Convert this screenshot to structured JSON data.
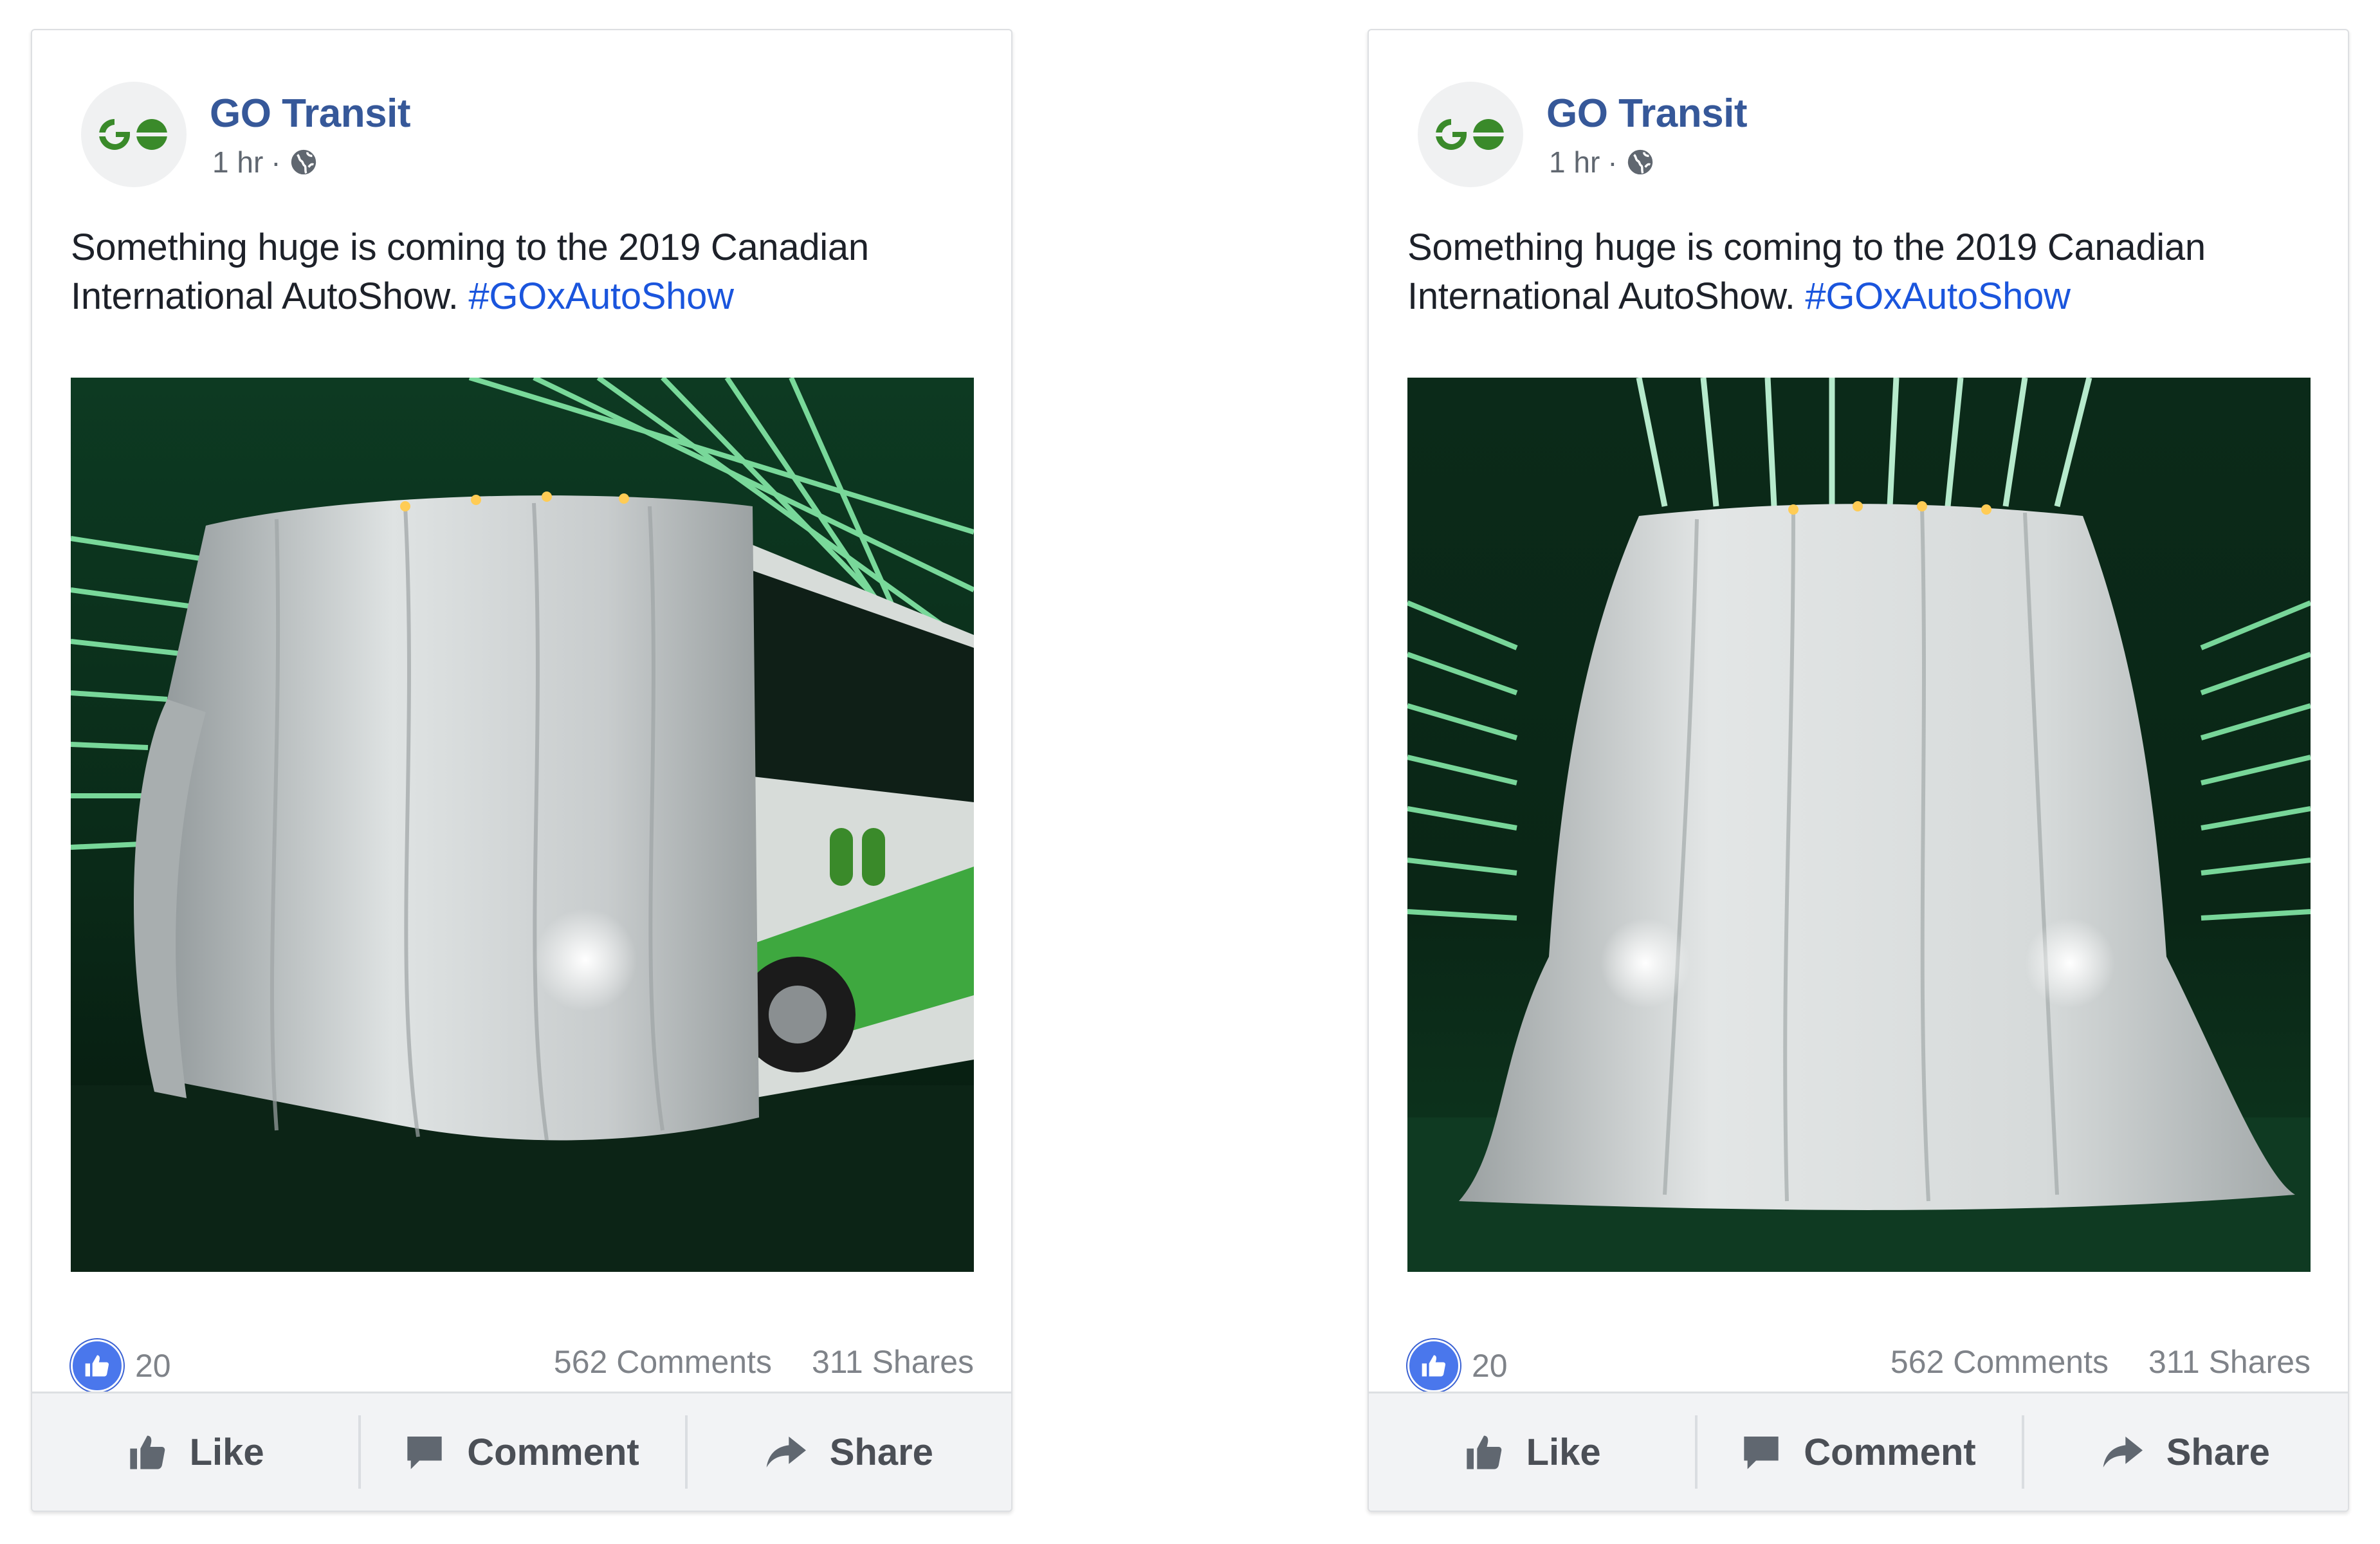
{
  "posts": [
    {
      "page_name": "GO Transit",
      "time": "1 hr",
      "separator": "·",
      "audience_icon": "globe-icon",
      "text": "Something huge is coming to the 2019 Canadian International AutoShow. ",
      "hashtag": "#GOxAutoShow",
      "photo": "covered-bus-angled-view",
      "reactions": "20",
      "comments": "562 Comments",
      "shares": "311 Shares",
      "actions": {
        "like": "Like",
        "comment": "Comment",
        "share": "Share"
      }
    },
    {
      "page_name": "GO Transit",
      "time": "1 hr",
      "separator": "·",
      "audience_icon": "globe-icon",
      "text": "Something huge is coming to the 2019 Canadian International AutoShow. ",
      "hashtag": "#GOxAutoShow",
      "photo": "covered-bus-front-view",
      "reactions": "20",
      "comments": "562 Comments",
      "shares": "311 Shares",
      "actions": {
        "like": "Like",
        "comment": "Comment",
        "share": "Share"
      }
    }
  ],
  "colors": {
    "brand_green": "#3a8a2a",
    "link_blue": "#365899",
    "hashtag_blue": "#1a55dd",
    "like_blue": "#4a77ec"
  }
}
